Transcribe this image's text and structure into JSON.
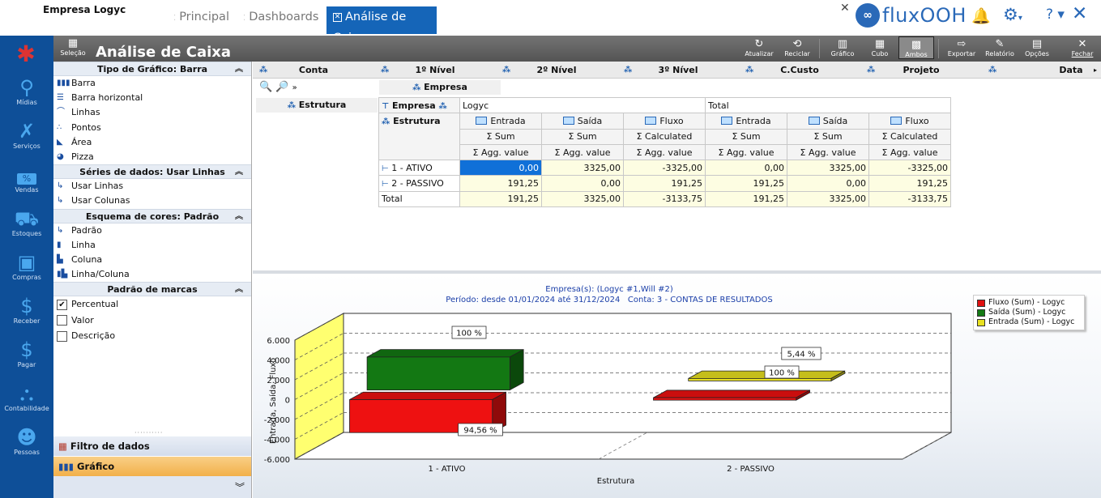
{
  "top": {
    "company": "Empresa Logyc",
    "tabs": [
      "Principal",
      "Dashboards",
      "Análise de Caixa"
    ],
    "logo_text": "fluxOOH",
    "logo_mark": "∞",
    "help": "? ▾",
    "close": "✕"
  },
  "side": {
    "items": [
      "Mídias",
      "Serviços",
      "Vendas",
      "Estoques",
      "Compras",
      "Receber",
      "Pagar",
      "Contabilidade",
      "Pessoas"
    ],
    "vendas_badge": "%"
  },
  "appbar": {
    "selecao": "Seleção",
    "title": "Análise de Caixa",
    "buttons": [
      "Atualizar",
      "Reciclar",
      "Gráfico",
      "Cubo",
      "Ambos",
      "Exportar",
      "Relatório",
      "Opções",
      "Fechar"
    ]
  },
  "left": {
    "sec_tipo": "Tipo de Gráfico: Barra",
    "tipos": [
      "Barra",
      "Barra horizontal",
      "Linhas",
      "Pontos",
      "Área",
      "Pizza"
    ],
    "sec_series": "Séries de dados: Usar Linhas",
    "series": [
      "Usar Linhas",
      "Usar Colunas"
    ],
    "sec_cores": "Esquema de cores: Padrão",
    "cores": [
      "Padrão",
      "Linha",
      "Coluna",
      "Linha/Coluna"
    ],
    "sec_marcas": "Padrão de marcas",
    "marcas": [
      {
        "label": "Percentual",
        "checked": true
      },
      {
        "label": "Valor",
        "checked": false
      },
      {
        "label": "Descrição",
        "checked": false
      }
    ],
    "filtro": "Filtro de dados",
    "grafico": "Gráfico"
  },
  "pivot": {
    "fields": [
      "Conta",
      "1º Nível",
      "2º Nível",
      "3º Nível",
      "C.Custo",
      "Projeto",
      "Data"
    ],
    "empresa_field": "Empresa",
    "estrutura_field": "Estrutura",
    "col_field": "Empresa",
    "row_field": "Estrutura",
    "group_logyc": "Logyc",
    "group_total": "Total",
    "measures": [
      "Entrada",
      "Saída",
      "Fluxo",
      "Entrada",
      "Saída",
      "Fluxo"
    ],
    "summary": [
      "Σ Sum",
      "Σ Sum",
      "Σ Calculated",
      "Σ Sum",
      "Σ Sum",
      "Σ Calculated"
    ],
    "agg": [
      "Σ Agg. value",
      "Σ Agg. value",
      "Σ Agg. value",
      "Σ Agg. value",
      "Σ Agg. value",
      "Σ Agg. value"
    ],
    "rows": [
      {
        "label": "1 - ATIVO",
        "values": [
          "0,00",
          "3325,00",
          "-3325,00",
          "0,00",
          "3325,00",
          "-3325,00"
        ]
      },
      {
        "label": "2 - PASSIVO",
        "values": [
          "191,25",
          "0,00",
          "191,25",
          "191,25",
          "0,00",
          "191,25"
        ]
      },
      {
        "label": "Total",
        "values": [
          "191,25",
          "3325,00",
          "-3133,75",
          "191,25",
          "3325,00",
          "-3133,75"
        ]
      }
    ]
  },
  "chart": {
    "title_line1": "Empresa(s): (Logyc #1,Will #2)",
    "title_line2": "Período: desde 01/01/2024 até 31/12/2024   Conta: 3 - CONTAS DE RESULTADOS",
    "legend": [
      {
        "name": "Fluxo (Sum) - Logyc",
        "color": "#e01010"
      },
      {
        "name": "Saída (Sum) - Logyc",
        "color": "#147a14"
      },
      {
        "name": "Entrada (Sum) - Logyc",
        "color": "#e8e020"
      }
    ],
    "data_labels": [
      "100 %",
      "94,56 %",
      "5,44 %",
      "100 %"
    ]
  },
  "chart_data": {
    "type": "bar",
    "categories": [
      "1 - ATIVO",
      "2 - PASSIVO"
    ],
    "series": [
      {
        "name": "Fluxo (Sum) - Logyc",
        "values": [
          -3325.0,
          191.25
        ]
      },
      {
        "name": "Saída (Sum) - Logyc",
        "values": [
          3325.0,
          0.0
        ]
      },
      {
        "name": "Entrada (Sum) - Logyc",
        "values": [
          0.0,
          191.25
        ]
      }
    ],
    "xlabel": "Estrutura",
    "ylabel": "Entrada, Saída, Fluxo",
    "yticks": [
      "6.000",
      "4.000",
      "2.000",
      "0",
      "-2.000",
      "-4.000",
      "-6.000"
    ],
    "ylim": [
      -6000,
      6000
    ],
    "grid": true,
    "legend_position": "top-right"
  }
}
